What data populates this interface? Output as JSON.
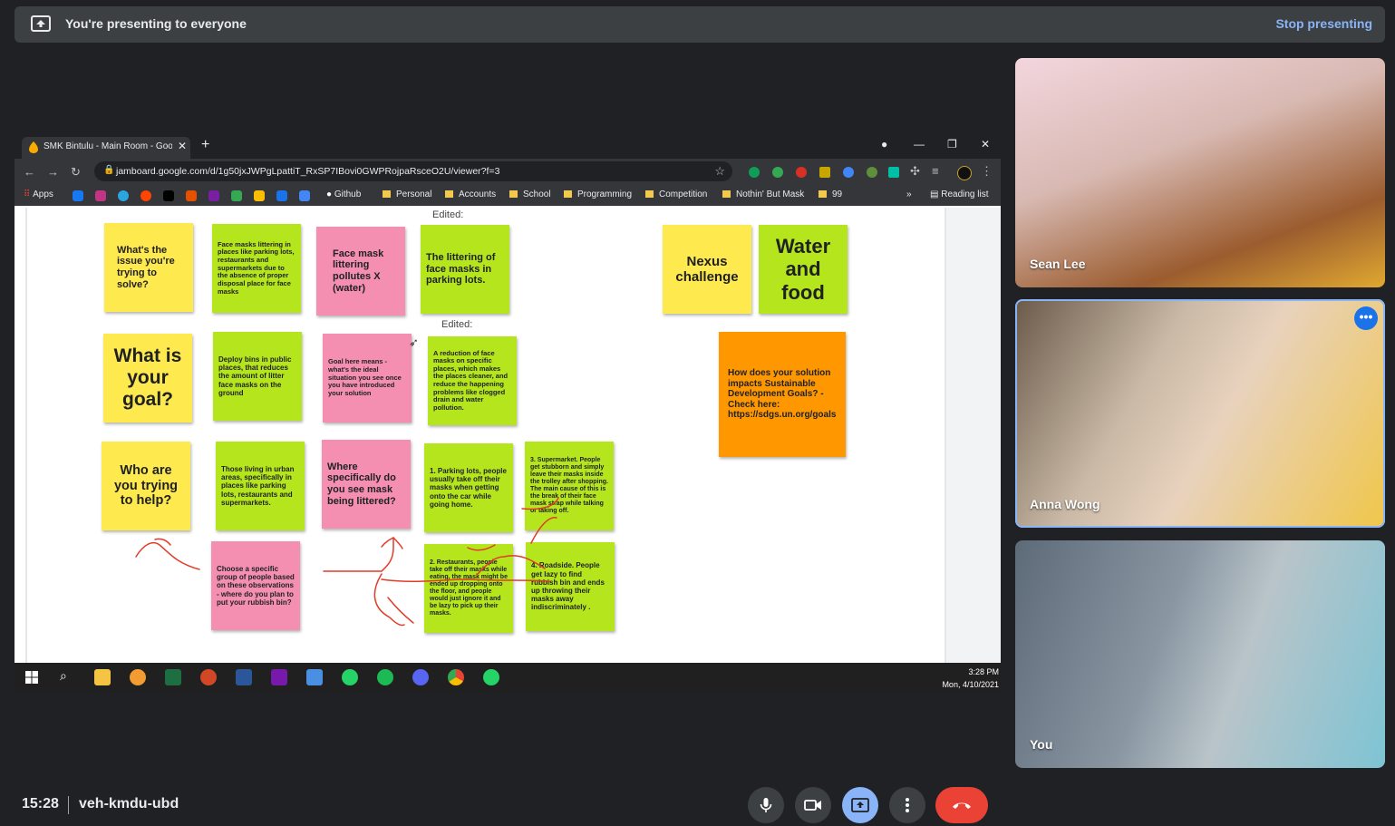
{
  "presenting": {
    "message": "You're presenting to everyone",
    "stop_label": "Stop presenting"
  },
  "browser": {
    "tab_title": "SMK Bintulu - Main Room - Goog",
    "url": "jamboard.google.com/d/1g50jxJWPgLpattiT_RxSP7IBovi0GWPRojpaRsceO2U/viewer?f=3",
    "bookmarks": {
      "apps": "Apps",
      "github": "Github",
      "personal": "Personal",
      "accounts": "Accounts",
      "school": "School",
      "programming": "Programming",
      "competition": "Competition",
      "nothin": "Nothin' But Mask",
      "n99": "99",
      "reading": "Reading list"
    }
  },
  "board": {
    "edited_1": "Edited:",
    "edited_2": "Edited:",
    "n1": "What's the issue you're trying to solve?",
    "n2": "Face masks littering in places like parking lots, restaurants and supermarkets due to the absence of proper disposal place for face masks",
    "n3": "Face mask littering pollutes X (water)",
    "n4": "The littering of face masks in parking lots.",
    "n5": "Nexus challenge",
    "n6": "Water and food",
    "n7": "What is your goal?",
    "n8": "Deploy bins in public places, that reduces the amount of litter face masks on the ground",
    "n9": "Goal here means - what's the ideal situation you see once you have introduced your solution",
    "n10": "A reduction of face masks on specific places, which makes the places cleaner, and reduce the happening problems like clogged drain and water pollution.",
    "n11": "How does your solution impacts Sustainable Development Goals? - Check here: https://sdgs.un.org/goals",
    "n12": "Who are you trying to help?",
    "n13": "Those living in urban areas, specifically in places like parking lots, restaurants and supermarkets.",
    "n14": "Where specifically do you see mask being littered?",
    "n15": "1. Parking lots, people usually take off their masks when getting onto the car while going home.",
    "n16": "3. Supermarket. People get stubborn and simply leave their masks inside the trolley after shopping. The main cause of this is the break of their face mask strap while talking or taking off.",
    "n17": "Choose a specific group of people based on these observations - where do you plan to put your rubbish bin?",
    "n18": "2. Restaurants, people take off their masks while eating, the mask might be ended up dropping onto the floor, and people would just ignore it and be lazy to pick up their masks.",
    "n19": "4. Roadside. People get lazy to find rubbish bin and ends up throwing their masks away indiscriminately ."
  },
  "taskbar": {
    "time": "3:28 PM",
    "date": "Mon, 4/10/2021"
  },
  "participants": {
    "p1": "Sean Lee",
    "p2": "Anna Wong",
    "p3": "You"
  },
  "meeting": {
    "time": "15:28",
    "code": "veh-kmdu-ubd"
  },
  "colors": {
    "sticky_yellow": "#fee94e",
    "sticky_green": "#b5e61d",
    "sticky_pink": "#f48fb1",
    "sticky_orange": "#ff9800",
    "end_call": "#ea4335",
    "accent": "#8ab4f8"
  }
}
